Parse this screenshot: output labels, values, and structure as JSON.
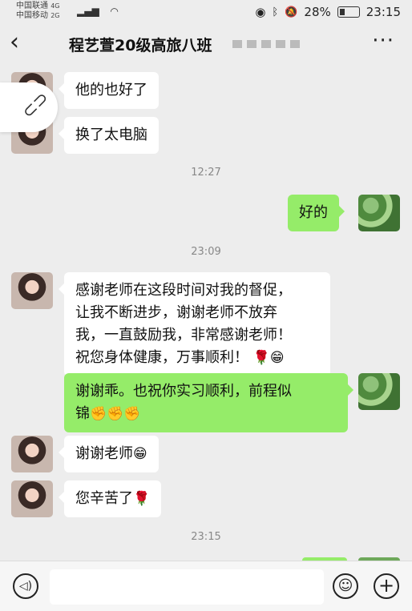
{
  "status_bar": {
    "carrier_1": "中国联通",
    "carrier_1_net": "4G",
    "carrier_2": "中国移动",
    "carrier_2_net": "2G",
    "battery": "28%",
    "time": "23:15"
  },
  "header": {
    "title": "程艺萱20级高旅八班"
  },
  "messages": [
    {
      "side": "in",
      "text": "他的也好了"
    },
    {
      "side": "in",
      "text": "换了太电脑"
    },
    {
      "type": "time",
      "text": "12:27"
    },
    {
      "side": "out",
      "text": "好的"
    },
    {
      "type": "time",
      "text": "23:09"
    },
    {
      "side": "in",
      "lines": [
        "感谢老师在这段时间对我的督促，",
        "让我不断进步，谢谢老师不放弃",
        "我，一直鼓励我，非常感谢老师！",
        "祝您身体健康，万事顺利！"
      ],
      "emojis": "🌹😁"
    },
    {
      "side": "out",
      "lines": [
        "谢谢乖。也祝你实习顺利，前程似",
        "锦"
      ],
      "emojis": "✊✊✊"
    },
    {
      "side": "in",
      "text": "谢谢老师",
      "emojis": "😁"
    },
    {
      "side": "in",
      "text": "您辛苦了",
      "emojis": "🌹"
    },
    {
      "type": "time",
      "text": "23:15"
    }
  ],
  "icons": {
    "back": "chevron-left-icon",
    "more": "more-dots-icon",
    "link": "link-icon",
    "voice": "voice-icon",
    "emoji": "emoji-icon",
    "plus": "plus-icon"
  },
  "colors": {
    "background": "#ededed",
    "outgoing_bubble": "#95ec69",
    "incoming_bubble": "#ffffff"
  }
}
